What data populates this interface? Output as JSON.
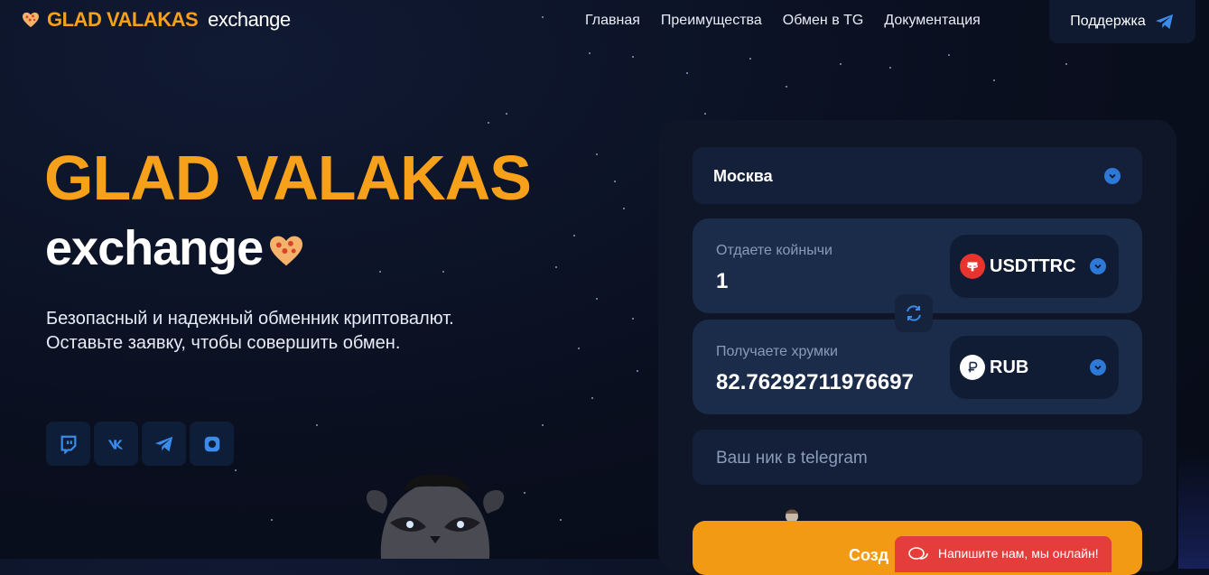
{
  "header": {
    "logo_brand": "GLAD VALAKAS",
    "logo_sub": "exchange",
    "menu": [
      "Главная",
      "Преимущества",
      "Обмен в TG",
      "Документация"
    ],
    "support_label": "Поддержка"
  },
  "hero": {
    "title": "GLAD VALAKAS",
    "subtitle": "exchange",
    "desc_line1": "Безопасный и надежный обменник криптовалют.",
    "desc_line2": "Оставьте заявку, чтобы совершить обмен."
  },
  "socials": [
    {
      "icon": "twitch-icon"
    },
    {
      "icon": "vk-icon"
    },
    {
      "icon": "telegram-icon"
    },
    {
      "icon": "instagram-icon"
    }
  ],
  "exchange": {
    "city": "Москва",
    "give_label": "Отдаете койнычи",
    "give_value": "1",
    "give_currency": "USDTTRC",
    "receive_label": "Получаете хрумки",
    "receive_value": "82.76292711976697",
    "receive_currency": "RUB",
    "nick_placeholder": "Ваш ник в telegram",
    "create_button": "Созд"
  },
  "chat_widget": {
    "text": "Напишите нам, мы онлайн!"
  },
  "colors": {
    "accent": "#f7a11a",
    "background": "#0a0f1f",
    "panel": "#0e1627",
    "field": "#1b2c4a",
    "chevron": "#2e78d8",
    "tether": "#e8332e",
    "chat": "#e53c3c"
  }
}
